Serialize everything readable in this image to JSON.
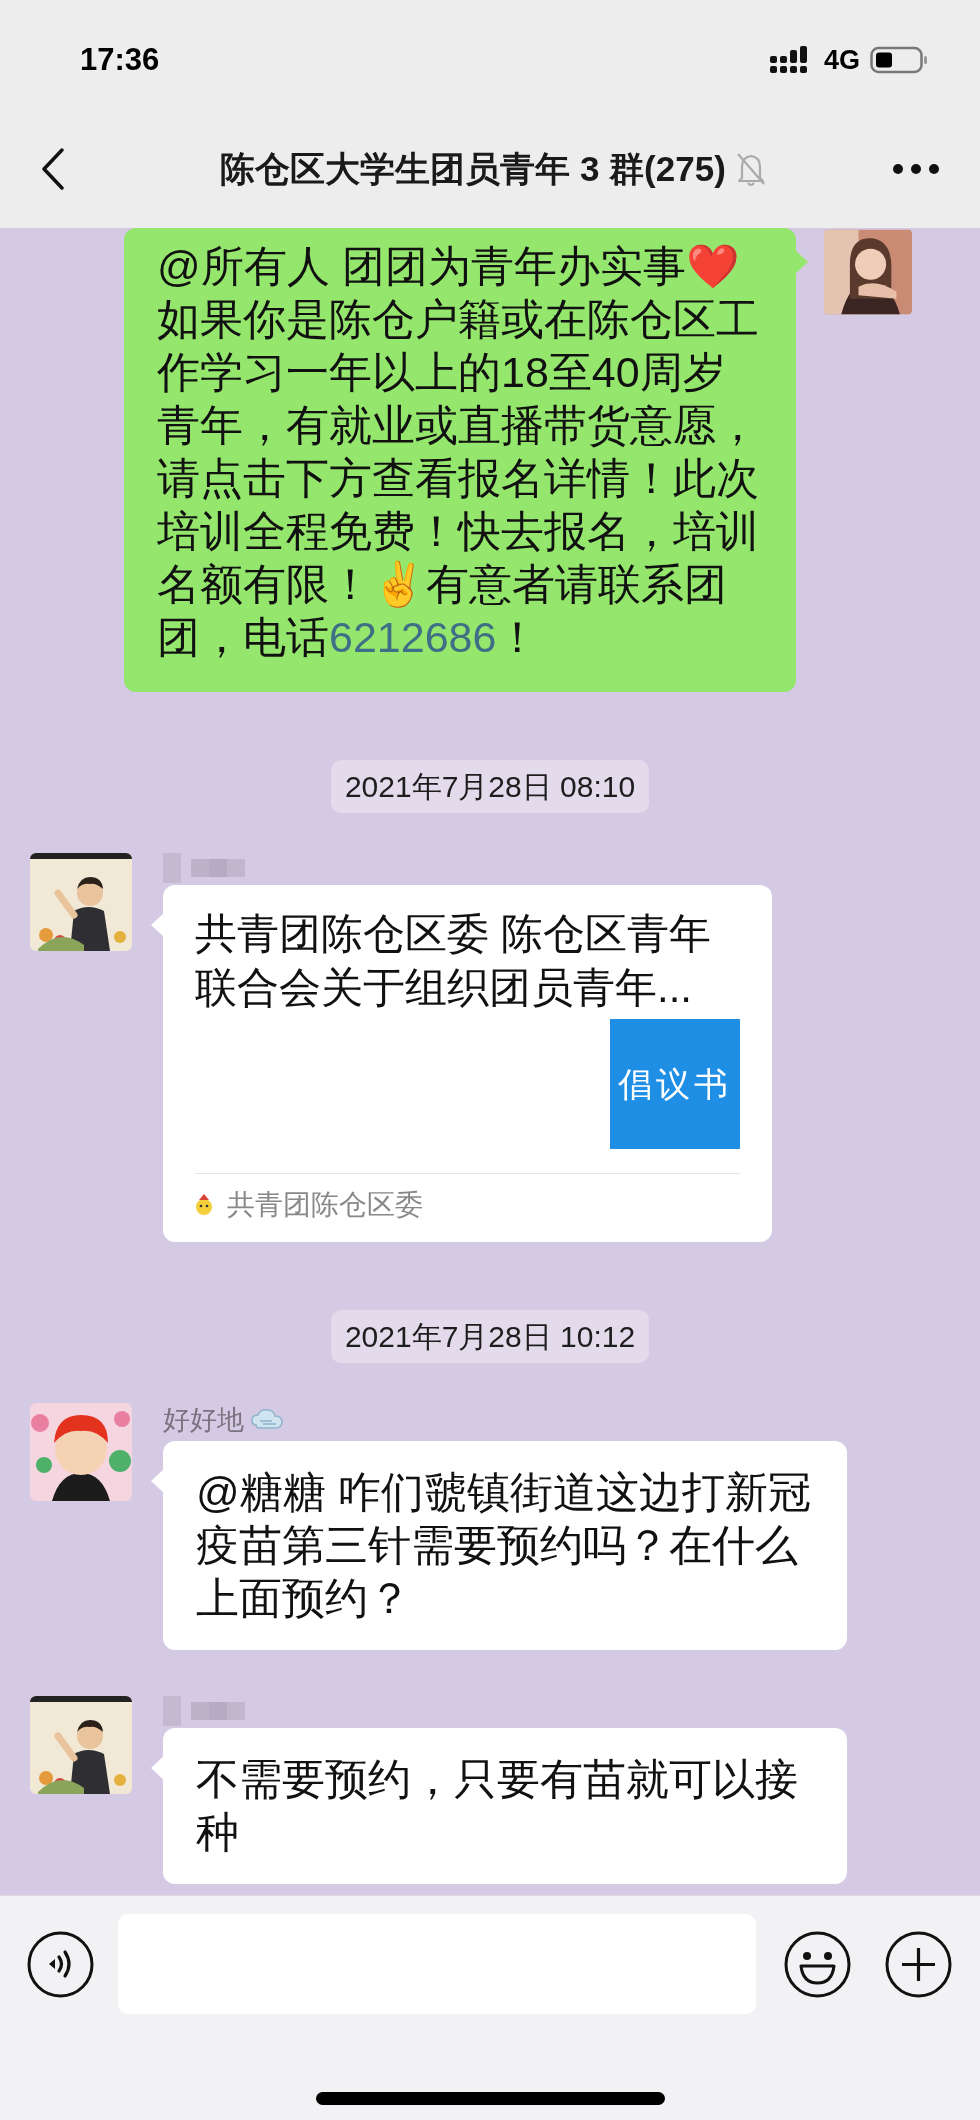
{
  "status_bar": {
    "time": "17:36",
    "network": "4G"
  },
  "header": {
    "title": "陈仓区大学生团员青年 3 群(275)",
    "muted": true
  },
  "messages": [
    {
      "kind": "sent_text",
      "parts": [
        {
          "kind": "text",
          "text": "@所有人 团团为青年办实事❤️\n如果你是陈仓户籍或在陈仓区工作学习一年以上的18至40周岁青年，有就业或直播带货意愿，请点击下方查看报名详情！此次培训全程免费！快去报名，培训名额有限！✌️有意者请联系团团，电话"
        },
        {
          "kind": "link",
          "text": "6212686"
        },
        {
          "kind": "text",
          "text": "！"
        }
      ]
    },
    {
      "kind": "time",
      "text": "2021年7月28日 08:10"
    },
    {
      "kind": "link_card",
      "name_hidden": true,
      "title": "共青团陈仓区委 陈仓区青年联合会关于组织团员青年...",
      "thumbnail": "倡议书",
      "source": "共青团陈仓区委"
    },
    {
      "kind": "time",
      "text": "2021年7月28日 10:12"
    },
    {
      "kind": "received_text",
      "name_hidden": false,
      "sender": "好好地",
      "parts": [
        {
          "kind": "text",
          "text": "@糖糖 咋们虢镇街道这边打新冠疫苗第三针需要预约吗？在什么上面预约？"
        }
      ]
    },
    {
      "kind": "received_text",
      "name_hidden": true,
      "parts": [
        {
          "kind": "text",
          "text": "不需要预约，只要有苗就可以接种"
        }
      ]
    }
  ]
}
